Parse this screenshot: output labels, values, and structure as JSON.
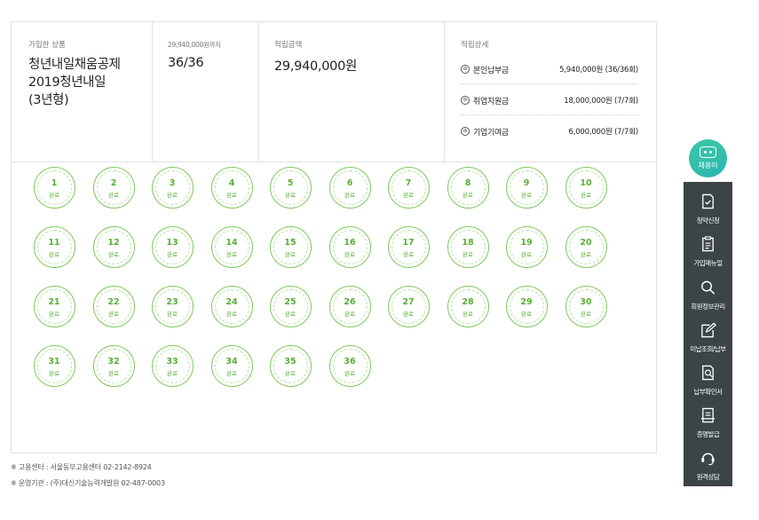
{
  "summary": {
    "product_label": "가입한 상품",
    "product_lines": [
      "청년내일채움공제",
      "2019청년내일",
      "(3년형)"
    ],
    "progress_label": "29,940,000원까지",
    "progress_value": "36/36",
    "amount_label": "적립금액",
    "amount_value": "29,940,000원",
    "details_label": "적립상세",
    "details": [
      {
        "name": "본인납부금",
        "value": "5,940,000원 (36/36회)"
      },
      {
        "name": "취업지원금",
        "value": "18,000,000원 (7/7회)"
      },
      {
        "name": "기업기여금",
        "value": "6,000,000원 (7/7회)"
      }
    ],
    "detail_icon_glyph": "⊛"
  },
  "installments": {
    "status_label": "완료",
    "numbers": [
      "1",
      "2",
      "3",
      "4",
      "5",
      "6",
      "7",
      "8",
      "9",
      "10",
      "11",
      "12",
      "13",
      "14",
      "15",
      "16",
      "17",
      "18",
      "19",
      "20",
      "21",
      "22",
      "23",
      "24",
      "25",
      "26",
      "27",
      "28",
      "29",
      "30",
      "31",
      "32",
      "33",
      "34",
      "35",
      "36"
    ],
    "color": "#58b036"
  },
  "footer": {
    "line1": "※ 고용센터 : 서울동부고용센터 02-2142-8924",
    "line2": "※ 운영기관 : (주)대신기술능력개발원 02-487-0003"
  },
  "chatbot": {
    "label": "채용이",
    "icon": "chatbot-icon"
  },
  "sidebar": {
    "items": [
      {
        "label": "청약신청",
        "icon": "document-check-icon"
      },
      {
        "label": "가입매뉴얼",
        "icon": "clipboard-icon"
      },
      {
        "label": "회원정보관리",
        "icon": "search-icon"
      },
      {
        "label": "미납조회/납부",
        "icon": "edit-icon"
      },
      {
        "label": "납부확인서",
        "icon": "document-search-icon"
      },
      {
        "label": "증명발급",
        "icon": "certificate-icon"
      },
      {
        "label": "원격상담",
        "icon": "headset-icon"
      }
    ]
  }
}
